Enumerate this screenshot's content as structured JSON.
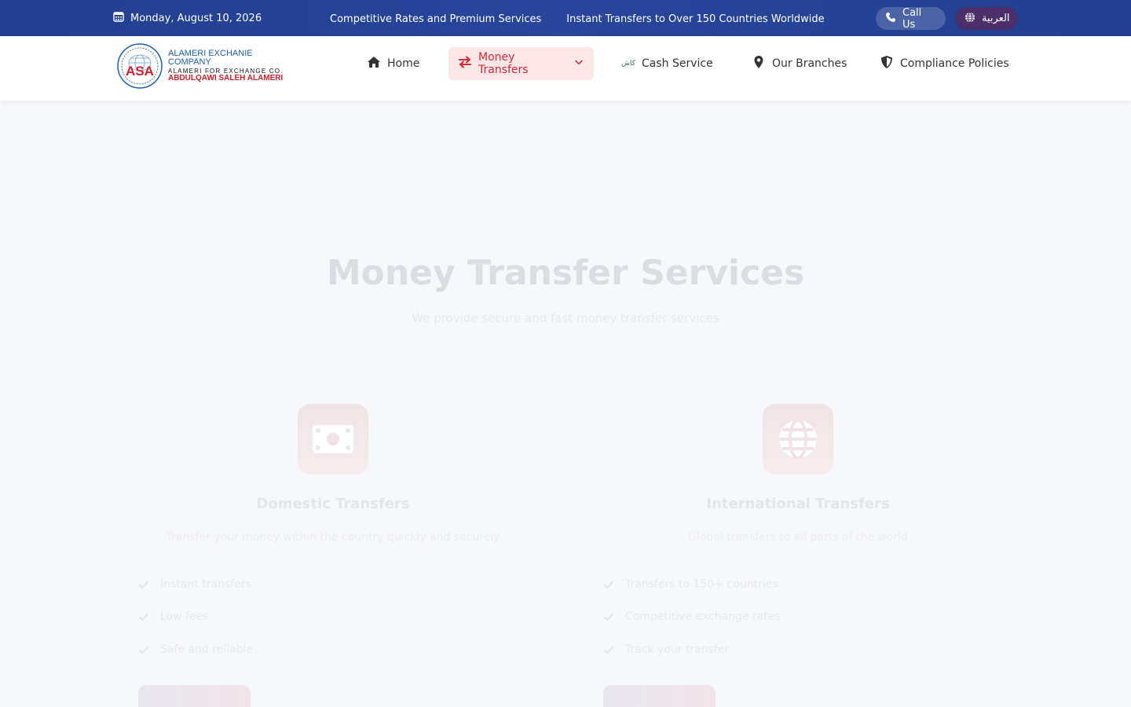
{
  "topbar": {
    "date": "Monday, August 10, 2026",
    "ticker": [
      "Competitive Rates and Premium Services",
      "Instant Transfers to Over 150 Countries Worldwide"
    ],
    "call_label": "Call Us",
    "lang_label": "العربية"
  },
  "logo": {
    "line1": "ALAMERI EXCHANIE",
    "line2": "COMPANY",
    "line3": "ALAMERI FOR EXCHANGE CO.",
    "line4": "ABDULQAWI SALEH ALAMERI",
    "seal_text": "ASA"
  },
  "nav": {
    "items": [
      {
        "label": "Home",
        "icon": "home-icon"
      },
      {
        "label": "Money Transfers",
        "icon": "transfer-arrows-icon",
        "active": true
      },
      {
        "label": "Cash Service",
        "icon": "cash-logo-icon",
        "icon_text": "كاش"
      },
      {
        "label": "Our Branches",
        "icon": "map-pin-icon"
      },
      {
        "label": "Compliance Policies",
        "icon": "shield-icon"
      }
    ]
  },
  "hero": {
    "title": "Money Transfer Services",
    "subtitle": "We provide secure and fast money transfer services"
  },
  "cards": [
    {
      "title": "Domestic Transfers",
      "desc": "Transfer your money within the country quickly and securely",
      "icon": "banknote-icon",
      "features": [
        "Instant transfers",
        "Low fees",
        "Safe and reliable"
      ]
    },
    {
      "title": "International Transfers",
      "desc": "Global transfers to all parts of the world",
      "icon": "globe-icon",
      "features": [
        "Transfers to 150+ countries",
        "Competitive exchange rates",
        "Track your transfer"
      ]
    }
  ],
  "colors": {
    "topbar": "#22408f",
    "accent_red": "#d42a35",
    "active_bg": "#fde6e8"
  }
}
